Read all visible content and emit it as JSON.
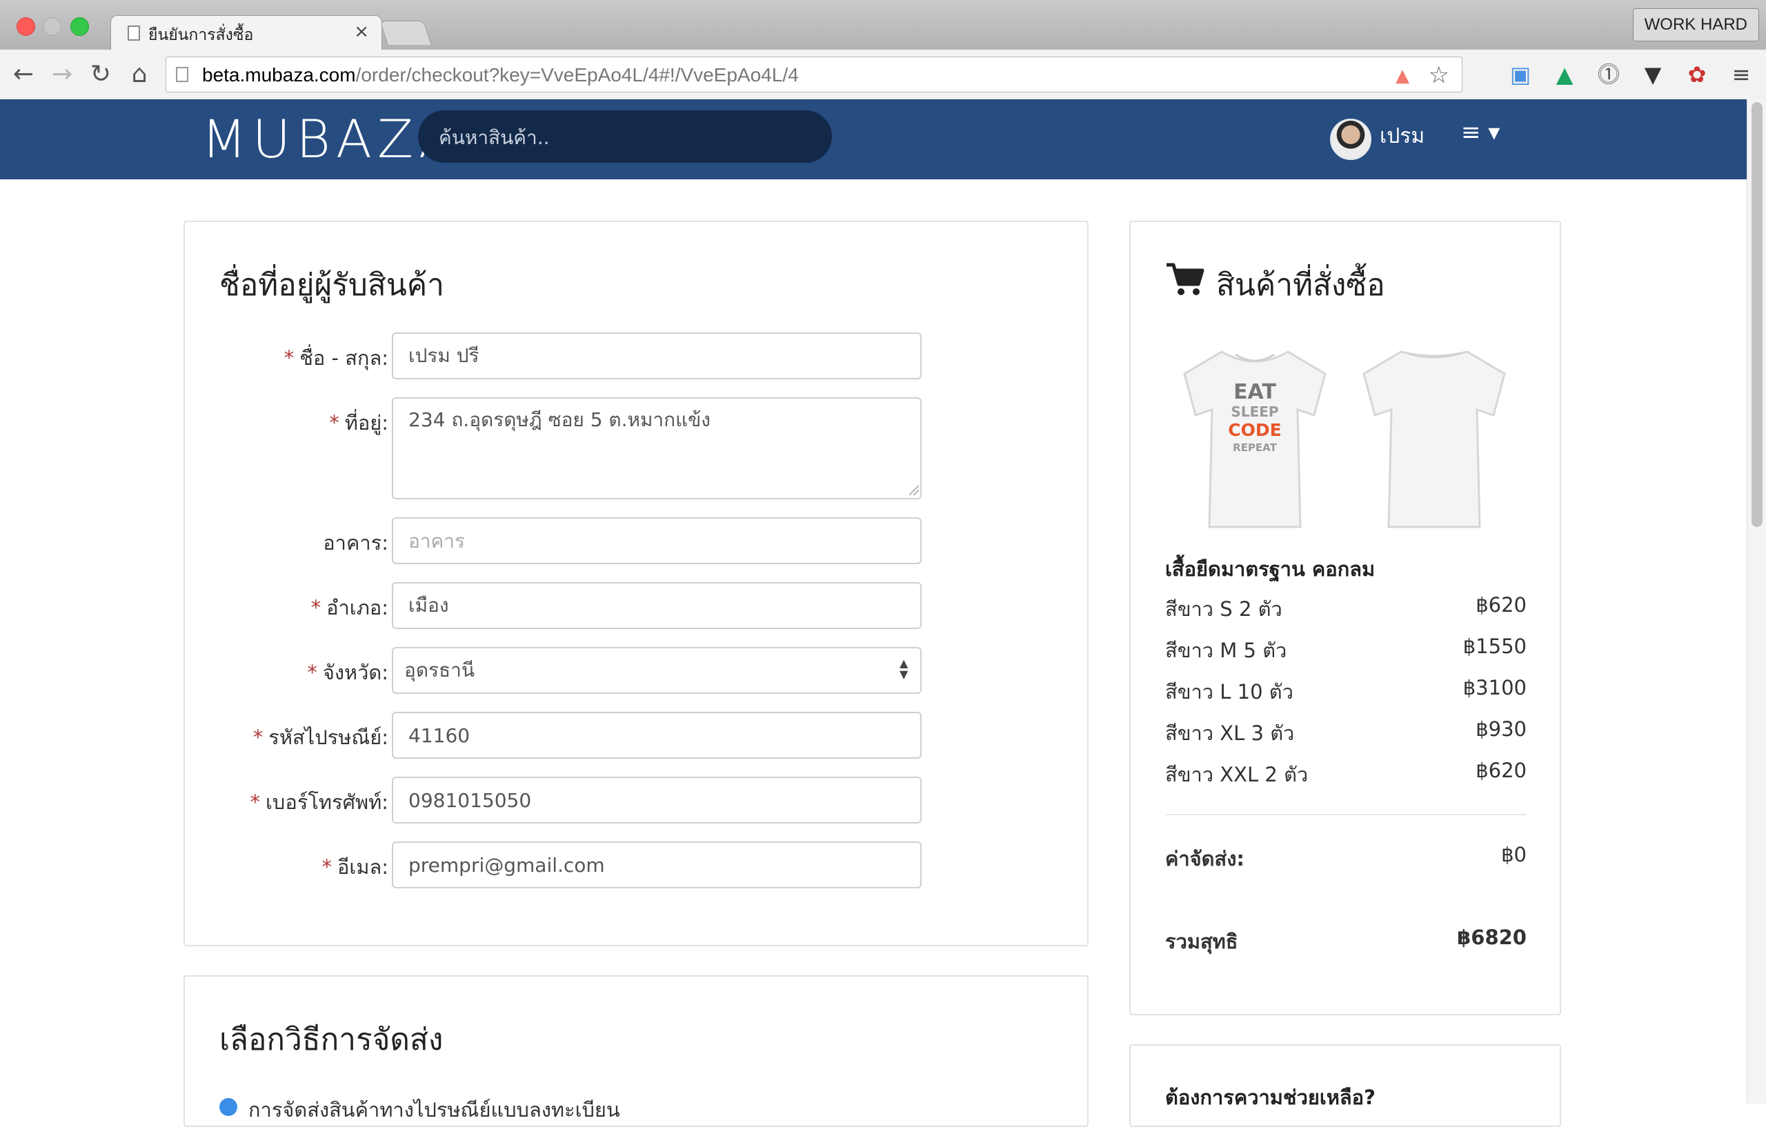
{
  "browser": {
    "tab_title": "ยืนยันการสั่งซื้อ",
    "tab_close": "×",
    "profile_badge": "WORK HARD",
    "url_host": "beta.mubaza.com",
    "url_path": "/order/checkout?key=VveEpAo4L/4#!/VveEpAo4L/4"
  },
  "header": {
    "logo": "MUBAZA",
    "search_placeholder": "ค้นหาสินค้า..",
    "user_name": "เปรม",
    "menu_glyph": "≡ ▾"
  },
  "address_form": {
    "title": "ชื่อที่อยู่ผู้รับสินค้า",
    "required_mark": "*",
    "fields": {
      "name": {
        "label": "ชื่อ - สกุล:",
        "value": "เปรม ปรี"
      },
      "address": {
        "label": "ที่อยู่:",
        "value": "234 ถ.อุดรดุษฎี ซอย 5 ต.หมากแข้ง"
      },
      "building": {
        "label": "อาคาร:",
        "placeholder": "อาคาร"
      },
      "district": {
        "label": "อำเภอ:",
        "value": "เมือง"
      },
      "province": {
        "label": "จังหวัด:",
        "value": "อุดรธานี"
      },
      "postcode": {
        "label": "รหัสไปรษณีย์:",
        "value": "41160"
      },
      "phone": {
        "label": "เบอร์โทรศัพท์:",
        "value": "0981015050"
      },
      "email": {
        "label": "อีเมล:",
        "value": "prempri@gmail.com"
      }
    }
  },
  "shipping_method": {
    "title": "เลือกวิธีการจัดส่ง",
    "option_label": "การจัดส่งสินค้าทางไปรษณีย์แบบลงทะเบียน"
  },
  "order": {
    "title": "สินค้าที่สั่งซื้อ",
    "shirt_print": [
      "EAT",
      "SLEEP",
      "CODE",
      "REPEAT"
    ],
    "product_name": "เสื้อยืดมาตรฐาน คอกลม",
    "items": [
      {
        "label": "สีขาว S 2 ตัว",
        "price": "฿620"
      },
      {
        "label": "สีขาว M 5 ตัว",
        "price": "฿1550"
      },
      {
        "label": "สีขาว L 10 ตัว",
        "price": "฿3100"
      },
      {
        "label": "สีขาว XL 3 ตัว",
        "price": "฿930"
      },
      {
        "label": "สีขาว XXL 2 ตัว",
        "price": "฿620"
      }
    ],
    "shipping_label": "ค่าจัดส่ง:",
    "shipping_price": "฿0",
    "total_label": "รวมสุทธิ",
    "total_price": "฿6820"
  },
  "help": {
    "title": "ต้องการความช่วยเหลือ?"
  },
  "colors": {
    "header_bg": "#264c80",
    "search_bg": "#13294a",
    "required": "#b03a3a",
    "radio": "#3a8ee6",
    "code_orange": "#e8552a"
  },
  "icons": {
    "back": "back-arrow-icon",
    "forward": "forward-arrow-icon",
    "reload": "reload-icon",
    "home": "home-icon",
    "star": "star-icon",
    "cart": "shopping-cart-icon",
    "hamburger": "hamburger-menu-icon"
  }
}
